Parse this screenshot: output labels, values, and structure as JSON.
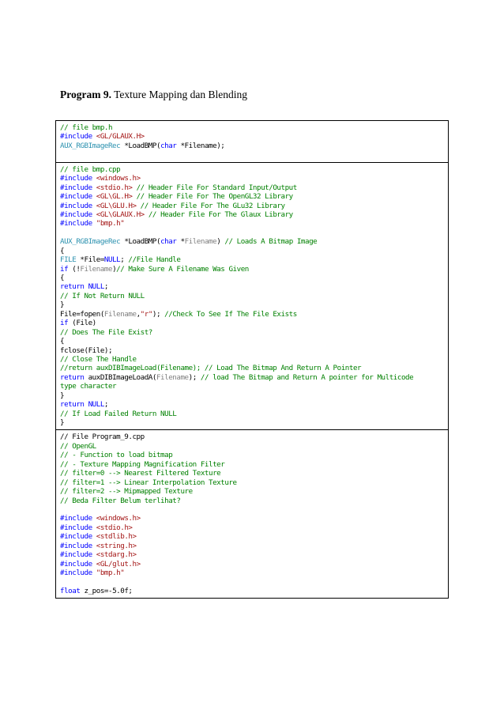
{
  "heading": {
    "bold": "Program 9.",
    "rest": " Texture Mapping dan Blending"
  },
  "blocks": [
    {
      "lines": [
        [
          {
            "t": "cm",
            "v": "// file bmp.h"
          }
        ],
        [
          {
            "t": "pp",
            "v": "#include"
          },
          {
            "t": "tx",
            "v": " "
          },
          {
            "t": "hd",
            "v": "<GL/GLAUX.H>"
          }
        ],
        [
          {
            "t": "ty",
            "v": "AUX_RGBImageRec"
          },
          {
            "t": "tx",
            "v": " *LoadBMP("
          },
          {
            "t": "kw",
            "v": "char"
          },
          {
            "t": "tx",
            "v": " *Filename);"
          }
        ],
        []
      ]
    },
    {
      "lines": [
        [
          {
            "t": "cm",
            "v": "// file bmp.cpp"
          }
        ],
        [
          {
            "t": "pp",
            "v": "#include"
          },
          {
            "t": "tx",
            "v": " "
          },
          {
            "t": "hd",
            "v": "<windows.h>"
          }
        ],
        [
          {
            "t": "pp",
            "v": "#include"
          },
          {
            "t": "tx",
            "v": " "
          },
          {
            "t": "hd",
            "v": "<stdio.h>"
          },
          {
            "t": "tx",
            "v": " "
          },
          {
            "t": "cm",
            "v": "// Header File For Standard Input/Output"
          }
        ],
        [
          {
            "t": "pp",
            "v": "#include"
          },
          {
            "t": "tx",
            "v": " "
          },
          {
            "t": "hd",
            "v": "<GL\\GL.H>"
          },
          {
            "t": "tx",
            "v": " "
          },
          {
            "t": "cm",
            "v": "// Header File For The OpenGL32 Library"
          }
        ],
        [
          {
            "t": "pp",
            "v": "#include"
          },
          {
            "t": "tx",
            "v": " "
          },
          {
            "t": "hd",
            "v": "<GL\\GLU.H>"
          },
          {
            "t": "tx",
            "v": " "
          },
          {
            "t": "cm",
            "v": "// Header File For The GLu32 Library"
          }
        ],
        [
          {
            "t": "pp",
            "v": "#include"
          },
          {
            "t": "tx",
            "v": " "
          },
          {
            "t": "hd",
            "v": "<GL\\GLAUX.H>"
          },
          {
            "t": "tx",
            "v": " "
          },
          {
            "t": "cm",
            "v": "// Header File For The Glaux Library"
          }
        ],
        [
          {
            "t": "pp",
            "v": "#include"
          },
          {
            "t": "tx",
            "v": " "
          },
          {
            "t": "hd",
            "v": "\"bmp.h\""
          }
        ],
        [],
        [
          {
            "t": "ty",
            "v": "AUX_RGBImageRec"
          },
          {
            "t": "tx",
            "v": " *LoadBMP("
          },
          {
            "t": "kw",
            "v": "char"
          },
          {
            "t": "tx",
            "v": " *"
          },
          {
            "t": "pa",
            "v": "Filename"
          },
          {
            "t": "tx",
            "v": ") "
          },
          {
            "t": "cm",
            "v": "// Loads A Bitmap Image"
          }
        ],
        [
          {
            "t": "tx",
            "v": "{"
          }
        ],
        [
          {
            "t": "ty",
            "v": "FILE"
          },
          {
            "t": "tx",
            "v": " *File="
          },
          {
            "t": "kw",
            "v": "NULL"
          },
          {
            "t": "tx",
            "v": "; "
          },
          {
            "t": "cm",
            "v": "//File Handle"
          }
        ],
        [
          {
            "t": "kw",
            "v": "if"
          },
          {
            "t": "tx",
            "v": " (!"
          },
          {
            "t": "pa",
            "v": "Filename"
          },
          {
            "t": "tx",
            "v": ")"
          },
          {
            "t": "cm",
            "v": "// Make Sure A Filename Was Given"
          }
        ],
        [
          {
            "t": "tx",
            "v": "{"
          }
        ],
        [
          {
            "t": "kw",
            "v": "return"
          },
          {
            "t": "tx",
            "v": " "
          },
          {
            "t": "kw",
            "v": "NULL"
          },
          {
            "t": "tx",
            "v": ";"
          }
        ],
        [
          {
            "t": "cm",
            "v": "// If Not Return NULL"
          }
        ],
        [
          {
            "t": "tx",
            "v": "}"
          }
        ],
        [
          {
            "t": "tx",
            "v": "File=fopen("
          },
          {
            "t": "pa",
            "v": "Filename"
          },
          {
            "t": "tx",
            "v": ","
          },
          {
            "t": "st",
            "v": "\"r\""
          },
          {
            "t": "tx",
            "v": "); "
          },
          {
            "t": "cm",
            "v": "//Check To See If The File Exists"
          }
        ],
        [
          {
            "t": "kw",
            "v": "if"
          },
          {
            "t": "tx",
            "v": " (File)"
          }
        ],
        [
          {
            "t": "cm",
            "v": "// Does The File Exist?"
          }
        ],
        [
          {
            "t": "tx",
            "v": "{"
          }
        ],
        [
          {
            "t": "tx",
            "v": "fclose(File);"
          }
        ],
        [
          {
            "t": "cm",
            "v": "// Close The Handle"
          }
        ],
        [
          {
            "t": "cm",
            "v": "//return auxDIBImageLoad(Filename); // Load The Bitmap And Return A Pointer"
          }
        ],
        [
          {
            "t": "kw",
            "v": "return"
          },
          {
            "t": "tx",
            "v": " auxDIBImageLoadA("
          },
          {
            "t": "pa",
            "v": "Filename"
          },
          {
            "t": "tx",
            "v": "); "
          },
          {
            "t": "cm",
            "v": "// load The Bitmap and Return A pointer for Multicode"
          }
        ],
        [
          {
            "t": "cm",
            "v": "type character"
          }
        ],
        [
          {
            "t": "tx",
            "v": "}"
          }
        ],
        [
          {
            "t": "kw",
            "v": "return"
          },
          {
            "t": "tx",
            "v": " "
          },
          {
            "t": "kw",
            "v": "NULL"
          },
          {
            "t": "tx",
            "v": ";"
          }
        ],
        [
          {
            "t": "cm",
            "v": "// If Load Failed Return NULL"
          }
        ],
        [
          {
            "t": "tx",
            "v": "}"
          }
        ]
      ]
    },
    {
      "lines": [
        [
          {
            "t": "tx",
            "v": "// File Program_9.cpp"
          }
        ],
        [
          {
            "t": "cm",
            "v": "// OpenGL"
          }
        ],
        [
          {
            "t": "cm",
            "v": "// - Function to load bitmap"
          }
        ],
        [
          {
            "t": "cm",
            "v": "// - Texture Mapping Magnification Filter"
          }
        ],
        [
          {
            "t": "cm",
            "v": "// filter=0 --> Nearest Filtered Texture"
          }
        ],
        [
          {
            "t": "cm",
            "v": "// filter=1 --> Linear Interpolation Texture"
          }
        ],
        [
          {
            "t": "cm",
            "v": "// filter=2 --> Mipmapped Texture"
          }
        ],
        [
          {
            "t": "cm",
            "v": "// Beda Filter Belum terlihat?"
          }
        ],
        [],
        [
          {
            "t": "pp",
            "v": "#include"
          },
          {
            "t": "tx",
            "v": " "
          },
          {
            "t": "hd",
            "v": "<windows.h>"
          }
        ],
        [
          {
            "t": "pp",
            "v": "#include"
          },
          {
            "t": "tx",
            "v": " "
          },
          {
            "t": "hd",
            "v": "<stdio.h>"
          }
        ],
        [
          {
            "t": "pp",
            "v": "#include"
          },
          {
            "t": "tx",
            "v": " "
          },
          {
            "t": "hd",
            "v": "<stdlib.h>"
          }
        ],
        [
          {
            "t": "pp",
            "v": "#include"
          },
          {
            "t": "tx",
            "v": " "
          },
          {
            "t": "hd",
            "v": "<string.h>"
          }
        ],
        [
          {
            "t": "pp",
            "v": "#include"
          },
          {
            "t": "tx",
            "v": " "
          },
          {
            "t": "hd",
            "v": "<stdarg.h>"
          }
        ],
        [
          {
            "t": "pp",
            "v": "#include"
          },
          {
            "t": "tx",
            "v": " "
          },
          {
            "t": "hd",
            "v": "<GL/glut.h>"
          }
        ],
        [
          {
            "t": "pp",
            "v": "#include"
          },
          {
            "t": "tx",
            "v": " "
          },
          {
            "t": "hd",
            "v": "\"bmp.h\""
          }
        ],
        [],
        [
          {
            "t": "kw",
            "v": "float"
          },
          {
            "t": "tx",
            "v": " z_pos=-5.0f;"
          }
        ]
      ]
    }
  ]
}
